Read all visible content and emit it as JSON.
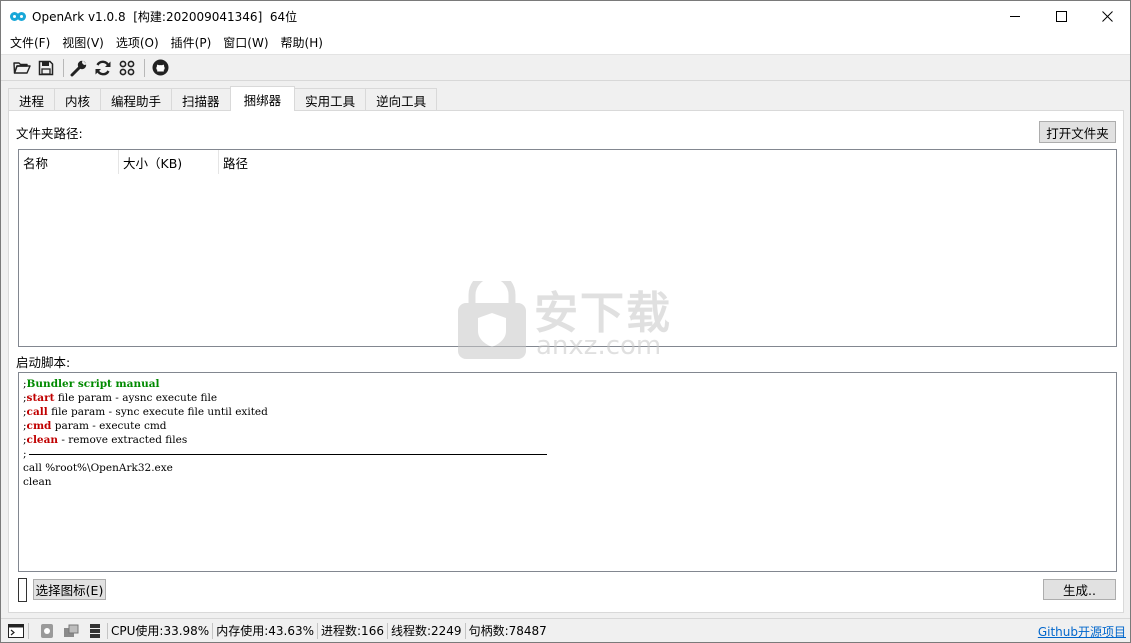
{
  "window": {
    "title": "OpenArk v1.0.8  [构建:202009041346]  64位",
    "controls": {
      "minimize": "minimize-icon",
      "maximize": "maximize-icon",
      "close": "close-icon"
    }
  },
  "menu": [
    "文件(F)",
    "视图(V)",
    "选项(O)",
    "插件(P)",
    "窗口(W)",
    "帮助(H)"
  ],
  "toolbar": {
    "icons": [
      "folder-open-icon",
      "save-icon",
      "wrench-icon",
      "refresh-icon",
      "grid-icon",
      "github-icon"
    ]
  },
  "tabs": [
    "进程",
    "内核",
    "编程助手",
    "扫描器",
    "捆绑器",
    "实用工具",
    "逆向工具"
  ],
  "active_tab": "捆绑器",
  "bundler": {
    "folder_path_label": "文件夹路径:",
    "open_folder_button": "打开文件夹",
    "columns": [
      "名称",
      "大小（KB)",
      "路径"
    ],
    "startup_script_label": "启动脚本:",
    "script": {
      "l1_prefix": ";",
      "l1_keyword": "Bundler script manual",
      "l2_prefix": ";",
      "l2_keyword": "start",
      "l2_rest": " file param - aysnc execute file",
      "l3_prefix": ";",
      "l3_keyword": "call",
      "l3_rest": " file param - sync execute file until exited",
      "l4_prefix": ";",
      "l4_keyword": "cmd",
      "l4_rest": " param - execute cmd",
      "l5_prefix": ";",
      "l5_keyword": "clean",
      "l5_rest": " - remove extracted files",
      "l6_prefix": ";",
      "l7": "call %root%\\OpenArk32.exe",
      "l8": "clean"
    },
    "select_icon_button": "选择图标(E)",
    "generate_button": "生成.."
  },
  "statusbar": {
    "icons": [
      "console-icon",
      "settings-icon",
      "plugin-icon",
      "server-icon"
    ],
    "cpu": "CPU使用:33.98%",
    "memory": "内存使用:43.63%",
    "processes": "进程数:166",
    "threads": "线程数:2249",
    "handles": "句柄数:78487",
    "github_link": "Github开源项目"
  },
  "watermark": {
    "cn": "安下载",
    "en": "anxz.com"
  }
}
